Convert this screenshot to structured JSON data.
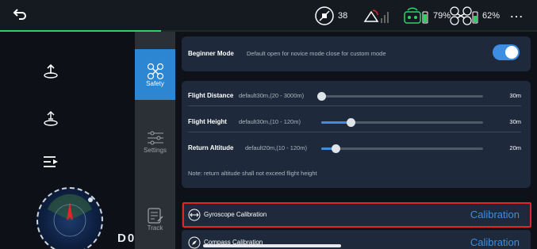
{
  "statusbar": {
    "satellite_count": "38",
    "remote_battery": "79%",
    "drone_battery": "62%",
    "more_icon": "…"
  },
  "leftnav": {
    "items": [
      {
        "name": "takeoff-icon"
      },
      {
        "name": "drone-return-icon"
      },
      {
        "name": "playlist-icon"
      }
    ],
    "telemetry_label": "D0"
  },
  "tabs": [
    {
      "label": "Safety",
      "active": true
    },
    {
      "label": "Settings",
      "active": false
    },
    {
      "label": "Track",
      "active": false
    }
  ],
  "beginner": {
    "title": "Beginner Mode",
    "desc": "Default open for novice mode close for custom mode",
    "enabled": true
  },
  "limits": {
    "flight_distance": {
      "title": "Flight Distance",
      "desc": "default30m,(20 - 3000m)",
      "value": "30m",
      "level": 0.0
    },
    "flight_height": {
      "title": "Flight Height",
      "desc": "default30m,(10 - 120m)",
      "value": "30m",
      "level": 0.18
    },
    "return_altitude": {
      "title": "Return Altitude",
      "desc": "default20m,(10 - 120m)",
      "value": "20m",
      "level": 0.09
    },
    "note": "Note: return altitude shall not exceed flight height"
  },
  "calibration": {
    "gyroscope": {
      "label": "Gyroscope Calibration",
      "action": "Calibration"
    },
    "compass": {
      "label": "Compass Calibration",
      "action": "Calibration"
    }
  },
  "colors": {
    "accent": "#3d8de0",
    "active_tab": "#2d86d2",
    "highlight": "#e2252a",
    "battery_green": "#2fd162"
  }
}
